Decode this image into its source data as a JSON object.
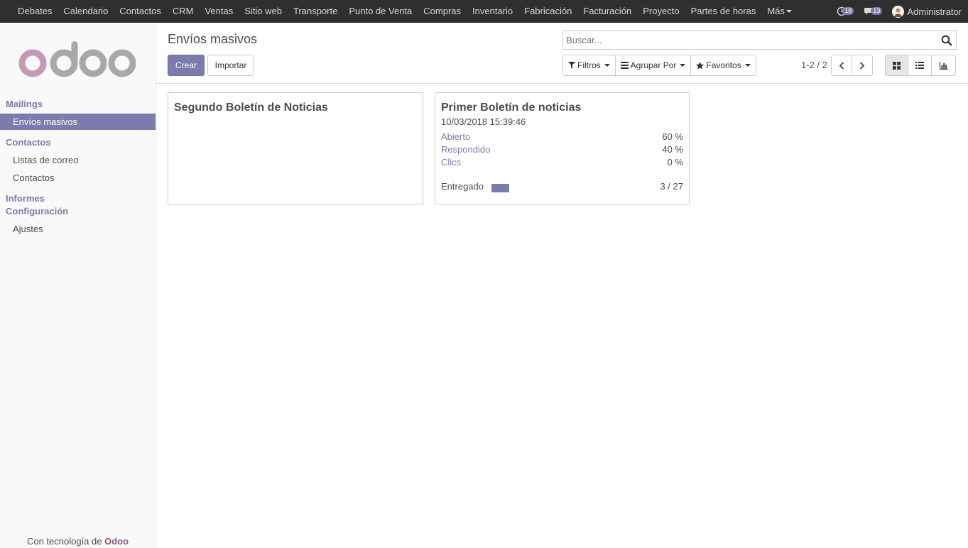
{
  "topbar": {
    "menu": [
      "Debates",
      "Calendario",
      "Contactos",
      "CRM",
      "Ventas",
      "Sitio web",
      "Transporte",
      "Punto de Venta",
      "Compras",
      "Inventario",
      "Fabricación",
      "Facturación",
      "Proyecto",
      "Partes de horas",
      "Más"
    ],
    "activity_count": "18",
    "messages_count": "13",
    "user_name": "Administrator"
  },
  "sidebar": {
    "sections": {
      "mailings": "Mailings",
      "contactos": "Contactos",
      "informes": "Informes",
      "configuracion": "Configuración"
    },
    "items": {
      "envios_masivos": "Envíos masivos",
      "listas_de_correo": "Listas de correo",
      "contactos": "Contactos",
      "ajustes": "Ajustes"
    },
    "footer_prefix": "Con tecnología de",
    "footer_brand": "Odoo"
  },
  "control": {
    "breadcrumb": "Envíos masivos",
    "create_label": "Crear",
    "import_label": "Importar",
    "search_placeholder": "Buscar...",
    "filters_label": "Filtros",
    "group_by_label": "Agrupar Por",
    "favorites_label": "Favoritos",
    "pager": "1-2 / 2"
  },
  "kanban": {
    "cards": [
      {
        "title": "Segundo Boletín de Noticias"
      },
      {
        "title": "Primer Boletín de noticias",
        "date": "10/03/2018 15:39:46",
        "opened_label": "Abierto",
        "opened_value": "60 %",
        "replied_label": "Respondido",
        "replied_value": "40 %",
        "clicks_label": "Clics",
        "clicks_value": "0 %",
        "delivered_label": "Entregado",
        "delivered_value": "3 / 27",
        "delivered_ratio": 0.111
      }
    ]
  },
  "colors": {
    "accent": "#7c7bad",
    "navbar": "#2f2f2f",
    "brand": "#875a7b"
  }
}
